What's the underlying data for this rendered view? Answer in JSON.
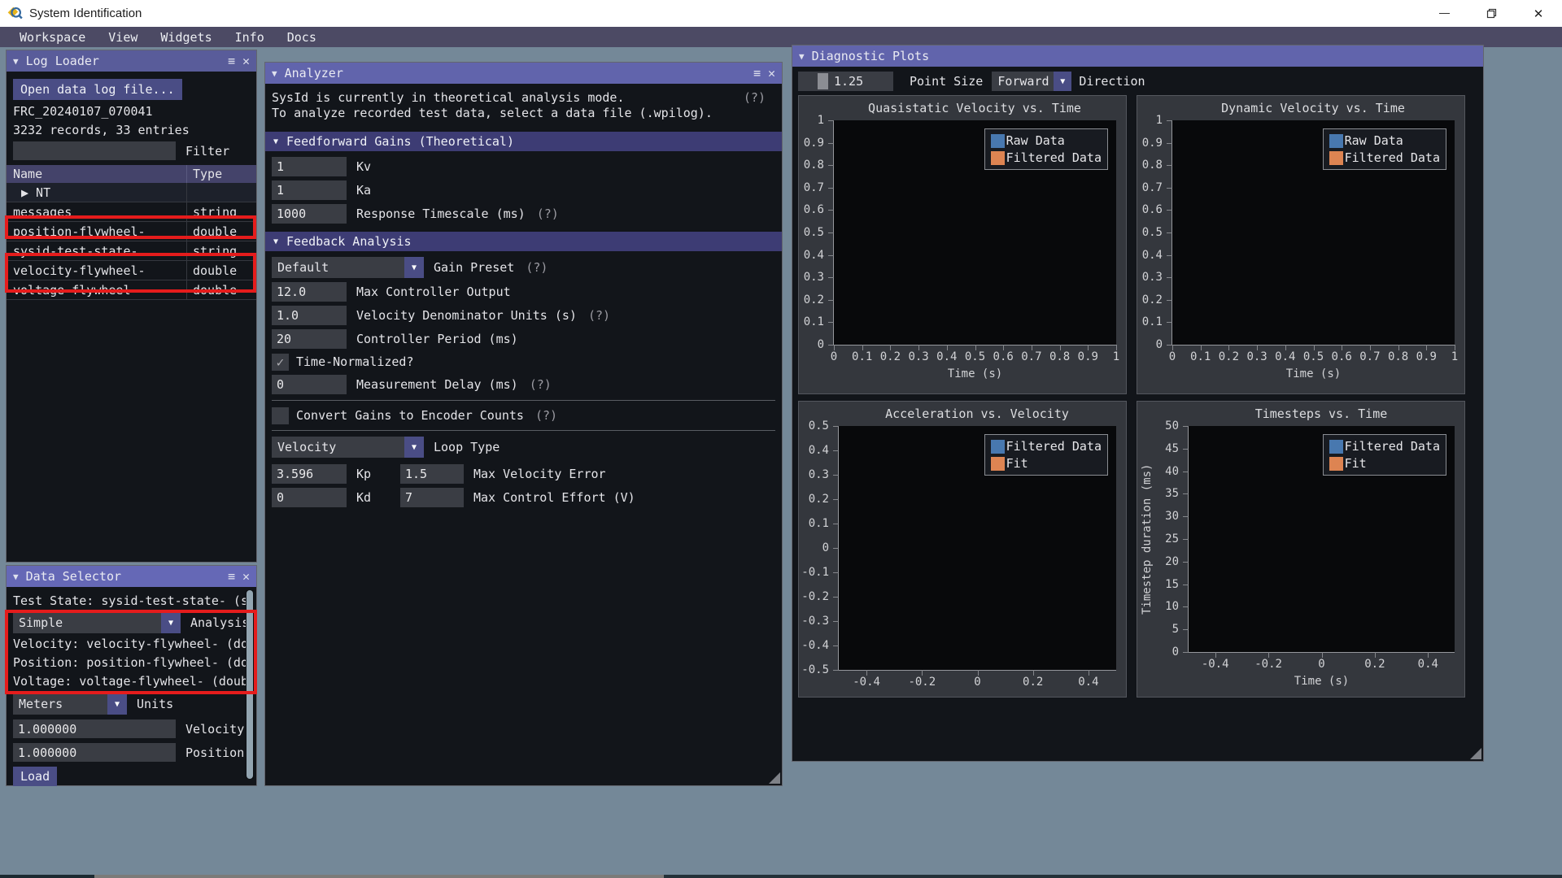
{
  "window": {
    "title": "System Identification",
    "menu": [
      "Workspace",
      "View",
      "Widgets",
      "Info",
      "Docs"
    ]
  },
  "colors": {
    "desktop": "#748898",
    "accent_purple": "#4a4d85",
    "header_purple": "#6164ac",
    "annotation_red": "#e51c1c",
    "legend_blue": "#4878af",
    "legend_orange": "#dd8452"
  },
  "log_loader": {
    "title": "Log Loader",
    "open_button": "Open data log file...",
    "file_name": "FRC_20240107_070041",
    "file_stats": "3232 records, 33 entries",
    "filter_value": "",
    "filter_label": "Filter",
    "table": {
      "columns": [
        "Name",
        "Type"
      ],
      "rows": [
        {
          "name": "NT",
          "type": "",
          "expandable": true
        },
        {
          "name": "messages",
          "type": "string"
        },
        {
          "name": "position-flywheel-",
          "type": "double",
          "highlighted": true
        },
        {
          "name": "sysid-test-state-",
          "type": "string"
        },
        {
          "name": "velocity-flywheel-",
          "type": "double",
          "highlighted": true
        },
        {
          "name": "voltage-flywheel-",
          "type": "double",
          "highlighted": true
        }
      ]
    }
  },
  "data_selector": {
    "title": "Data Selector",
    "test_state_line": "Test State: sysid-test-state- (s",
    "analysis_value": "Simple",
    "analysis_label": "Analysis",
    "velocity_line": "Velocity: velocity-flywheel- (do",
    "position_line": "Position: position-flywheel- (do",
    "voltage_line": "Voltage: voltage-flywheel- (doub",
    "units_value": "Meters",
    "units_label": "Units",
    "velocity_units_value": "1.000000",
    "velocity_units_label": "Velocity",
    "position_units_value": "1.000000",
    "position_units_label": "Position",
    "load_button": "Load"
  },
  "analyzer": {
    "title": "Analyzer",
    "mode_line1": "SysId is currently in theoretical analysis mode.",
    "mode_line2": "To analyze recorded test data, select a data file (.wpilog).",
    "help": "(?)",
    "feedforward_section": "Feedforward Gains (Theoretical)",
    "kv_value": "1",
    "kv_label": "Kv",
    "ka_value": "1",
    "ka_label": "Ka",
    "timescale_value": "1000",
    "timescale_label": "Response Timescale (ms)",
    "feedback_section": "Feedback Analysis",
    "gain_preset_value": "Default",
    "gain_preset_label": "Gain Preset",
    "max_output_value": "12.0",
    "max_output_label": "Max Controller Output",
    "vel_denom_value": "1.0",
    "vel_denom_label": "Velocity Denominator Units (s)",
    "period_value": "20",
    "period_label": "Controller Period (ms)",
    "time_normalized_label": "Time-Normalized?",
    "time_normalized_checked": true,
    "delay_value": "0",
    "delay_label": "Measurement Delay (ms)",
    "convert_label": "Convert Gains to Encoder Counts",
    "convert_checked": false,
    "loop_type_value": "Velocity",
    "loop_type_label": "Loop Type",
    "kp_value": "3.596",
    "kp_label": "Kp",
    "max_vel_err_value": "1.5",
    "max_vel_err_label": "Max Velocity Error",
    "kd_value": "0",
    "kd_label": "Kd",
    "max_effort_value": "7",
    "max_effort_label": "Max Control Effort (V)"
  },
  "diagnostic_plots": {
    "title": "Diagnostic Plots",
    "point_size_value": "1.25",
    "point_size_label": "Point Size",
    "direction_value": "Forward",
    "direction_label": "Direction"
  },
  "chart_data": [
    {
      "type": "scatter",
      "title": "Quasistatic Velocity vs. Time",
      "xlabel": "Time (s)",
      "ylabel": "",
      "xlim": [
        0,
        1
      ],
      "ylim": [
        0,
        1
      ],
      "xticks": [
        0,
        0.1,
        0.2,
        0.3,
        0.4,
        0.5,
        0.6,
        0.7,
        0.8,
        0.9,
        1
      ],
      "yticks": [
        0,
        0.1,
        0.2,
        0.3,
        0.4,
        0.5,
        0.6,
        0.7,
        0.8,
        0.9,
        1
      ],
      "grid": false,
      "legend_position": "top-right",
      "plot_bg": "#08090b",
      "series": [
        {
          "name": "Raw Data",
          "color": "#4878af",
          "points": []
        },
        {
          "name": "Filtered Data",
          "color": "#dd8452",
          "points": []
        }
      ]
    },
    {
      "type": "scatter",
      "title": "Dynamic Velocity vs. Time",
      "xlabel": "Time (s)",
      "ylabel": "",
      "xlim": [
        0,
        1
      ],
      "ylim": [
        0,
        1
      ],
      "xticks": [
        0,
        0.1,
        0.2,
        0.3,
        0.4,
        0.5,
        0.6,
        0.7,
        0.8,
        0.9,
        1
      ],
      "yticks": [
        0,
        0.1,
        0.2,
        0.3,
        0.4,
        0.5,
        0.6,
        0.7,
        0.8,
        0.9,
        1
      ],
      "grid": false,
      "legend_position": "top-right",
      "plot_bg": "#08090b",
      "series": [
        {
          "name": "Raw Data",
          "color": "#4878af",
          "points": []
        },
        {
          "name": "Filtered Data",
          "color": "#dd8452",
          "points": []
        }
      ]
    },
    {
      "type": "scatter",
      "title": "Acceleration vs. Velocity",
      "xlabel": "",
      "ylabel": "",
      "xlim": [
        -0.5,
        0.5
      ],
      "ylim": [
        -0.5,
        0.5
      ],
      "xticks": [
        -0.4,
        -0.2,
        0,
        0.2,
        0.4
      ],
      "yticks": [
        -0.5,
        -0.4,
        -0.3,
        -0.2,
        -0.1,
        0,
        0.1,
        0.2,
        0.3,
        0.4,
        0.5
      ],
      "grid": false,
      "legend_position": "top-right",
      "plot_bg": "#08090b",
      "series": [
        {
          "name": "Filtered Data",
          "color": "#4878af",
          "points": []
        },
        {
          "name": "Fit",
          "color": "#dd8452",
          "points": []
        }
      ]
    },
    {
      "type": "scatter",
      "title": "Timesteps vs. Time",
      "xlabel": "Time (s)",
      "ylabel": "Timestep duration (ms)",
      "xlim": [
        -0.5,
        0.5
      ],
      "ylim": [
        0,
        50
      ],
      "xticks": [
        -0.4,
        -0.2,
        0,
        0.2,
        0.4
      ],
      "yticks": [
        0,
        5,
        10,
        15,
        20,
        25,
        30,
        35,
        40,
        45,
        50
      ],
      "grid": false,
      "legend_position": "top-right",
      "plot_bg": "#08090b",
      "series": [
        {
          "name": "Filtered Data",
          "color": "#4878af",
          "points": []
        },
        {
          "name": "Fit",
          "color": "#dd8452",
          "points": []
        }
      ]
    }
  ]
}
